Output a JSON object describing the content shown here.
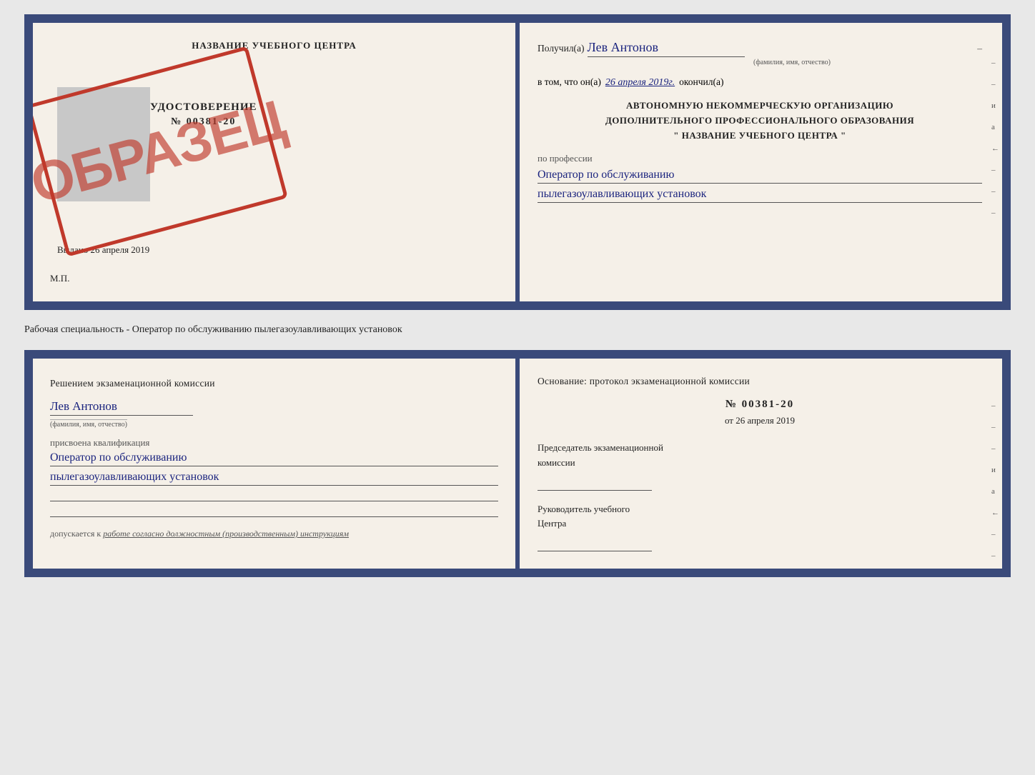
{
  "page1": {
    "left": {
      "title": "НАЗВАНИЕ УЧЕБНОГО ЦЕНТРА",
      "cert_word": "УДОСТОВЕРЕНИЕ",
      "cert_number": "№ 00381-20",
      "vydano_label": "Выдано",
      "vydano_date": "26 апреля 2019",
      "mp": "М.П.",
      "stamp_text": "ОБРАЗЕЦ"
    },
    "right": {
      "poluchil_label": "Получил(а)",
      "poluchil_name": "Лев Антонов",
      "fio_note": "(фамилия, имя, отчество)",
      "dash": "–",
      "vtom_label": "в том, что он(а)",
      "vtom_date": "26 апреля 2019г.",
      "okonchill_label": "окончил(а)",
      "org_line1": "АВТОНОМНУЮ НЕКОММЕРЧЕСКУЮ ОРГАНИЗАЦИЮ",
      "org_line2": "ДОПОЛНИТЕЛЬНОГО ПРОФЕССИОНАЛЬНОГО ОБРАЗОВАНИЯ",
      "org_line3": "\"   НАЗВАНИЕ УЧЕБНОГО ЦЕНТРА   \"",
      "po_professii": "по профессии",
      "profession_line1": "Оператор по обслуживанию",
      "profession_line2": "пылегазоулавливающих установок",
      "side_marks": [
        "–",
        "–",
        "и",
        "а",
        "←",
        "–",
        "–",
        "–"
      ]
    }
  },
  "separator": {
    "text": "Рабочая специальность - Оператор по обслуживанию пылегазоулавливающих установок"
  },
  "page2": {
    "left": {
      "resheniem_label": "Решением экзаменационной комиссии",
      "name": "Лев Антонов",
      "fio_note": "(фамилия, имя, отчество)",
      "prisvoena": "присвоена квалификация",
      "qualification_line1": "Оператор по обслуживанию",
      "qualification_line2": "пылегазоулавливающих установок",
      "dopuskaetsya_label": "допускается к",
      "dopuskaetsya_text": "работе согласно должностным (производственным) инструкциям"
    },
    "right": {
      "osnovanie_label": "Основание: протокол экзаменационной комиссии",
      "protocol_number": "№  00381-20",
      "ot_label": "от",
      "ot_date": "26 апреля 2019",
      "predsedatel_line1": "Председатель экзаменационной",
      "predsedatel_line2": "комиссии",
      "rukovoditel_line1": "Руководитель учебного",
      "rukovoditel_line2": "Центра",
      "side_marks": [
        "–",
        "–",
        "–",
        "и",
        "а",
        "←",
        "–",
        "–",
        "–"
      ]
    }
  }
}
